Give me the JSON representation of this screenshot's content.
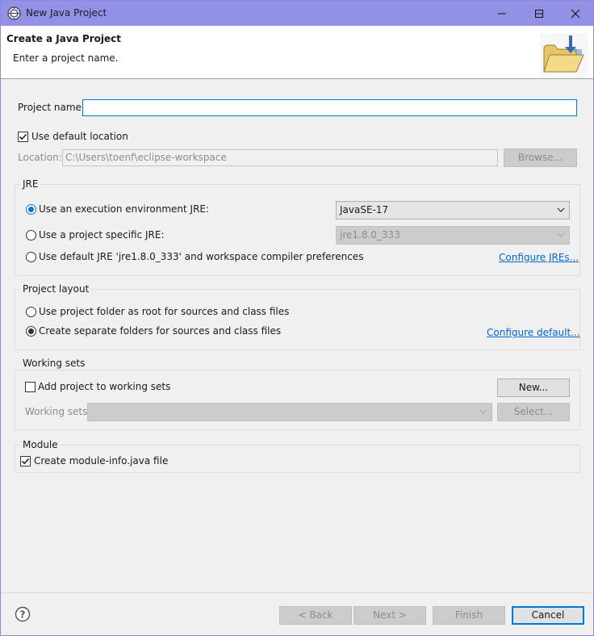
{
  "window": {
    "title": "New Java Project"
  },
  "header": {
    "title": "Create a Java Project",
    "description": "Enter a project name."
  },
  "project_name": {
    "label": "Project name:",
    "value": ""
  },
  "use_default_location": {
    "label": "Use default location",
    "checked": true
  },
  "location": {
    "label": "Location:",
    "value": "C:\\Users\\toenf\\eclipse-workspace",
    "browse_label": "Browse..."
  },
  "jre": {
    "group_label": "JRE",
    "option_execution_env": {
      "label": "Use an execution environment JRE:",
      "selected": true,
      "combo_value": "JavaSE-17"
    },
    "option_project_specific": {
      "label": "Use a project specific JRE:",
      "selected": false,
      "combo_value": "jre1.8.0_333"
    },
    "option_default": {
      "label": "Use default JRE 'jre1.8.0_333' and workspace compiler preferences",
      "selected": false
    },
    "configure_link": "Configure JREs..."
  },
  "project_layout": {
    "group_label": "Project layout",
    "option_root": {
      "label": "Use project folder as root for sources and class files",
      "selected": false
    },
    "option_separate": {
      "label": "Create separate folders for sources and class files",
      "selected": true
    },
    "configure_link": "Configure default..."
  },
  "working_sets": {
    "group_label": "Working sets",
    "add_label": "Add project to working sets",
    "add_checked": false,
    "new_label": "New...",
    "sets_label": "Working sets:",
    "sets_value": "",
    "select_label": "Select..."
  },
  "module": {
    "group_label": "Module",
    "create_label": "Create module-info.java file",
    "create_checked": true
  },
  "footer": {
    "back_label": "< Back",
    "next_label": "Next >",
    "finish_label": "Finish",
    "cancel_label": "Cancel"
  },
  "colors": {
    "titlebar": "#9391e5",
    "accent": "#0078d7",
    "link": "#0066cc"
  },
  "icons": [
    "eclipse-app-icon",
    "minimize-icon",
    "maximize-icon",
    "close-icon",
    "java-project-folder-icon",
    "chevron-down-icon",
    "checkmark-icon",
    "help-icon"
  ]
}
